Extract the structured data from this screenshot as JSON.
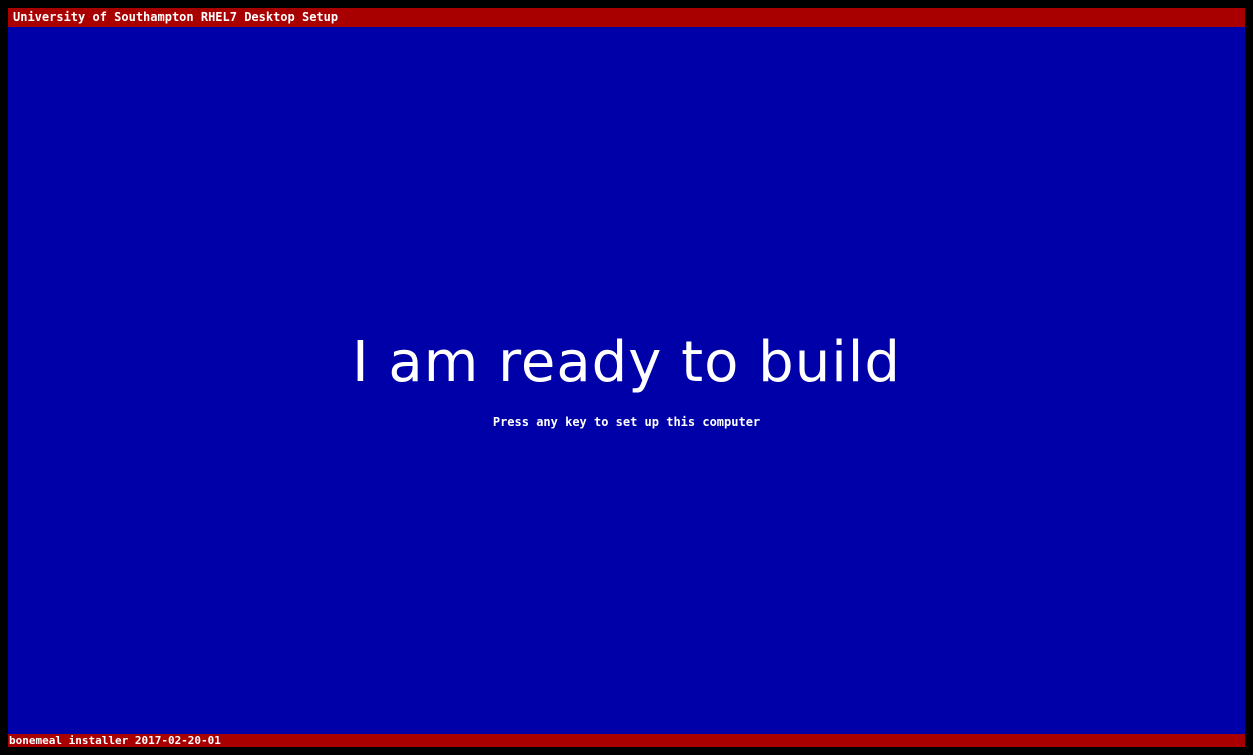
{
  "window": {
    "title": "University of Southampton RHEL7 Desktop Setup"
  },
  "main": {
    "headline": "I am ready to build",
    "prompt": "Press any key to set up this computer"
  },
  "status_bar": {
    "text": "bonemeal installer 2017-02-20-01"
  },
  "colors": {
    "background": "#0000a8",
    "bars": "#a80000",
    "text": "#ffffff"
  }
}
